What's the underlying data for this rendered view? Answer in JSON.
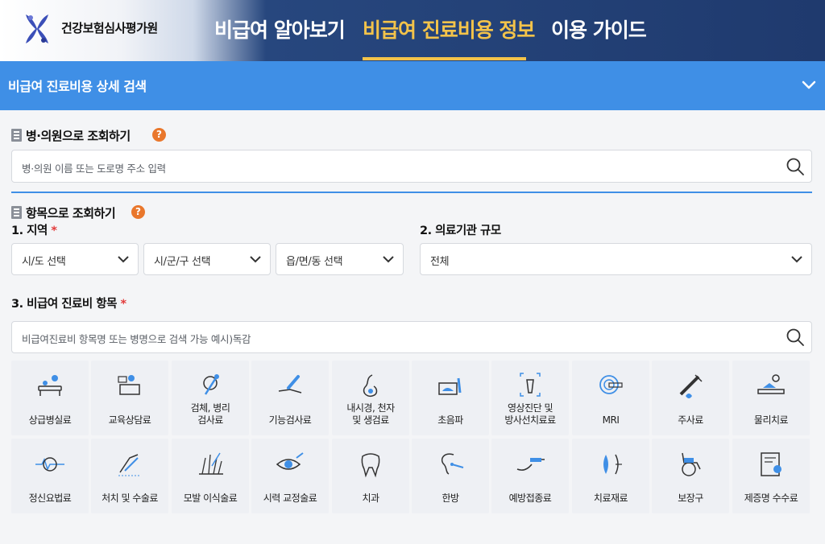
{
  "header": {
    "org_name": "건강보험심사평가원",
    "nav": [
      {
        "label": "비급여 알아보기",
        "active": false
      },
      {
        "label": "비급여 진료비용 정보",
        "active": true
      },
      {
        "label": "이용 가이드",
        "active": false
      }
    ]
  },
  "colors": {
    "primary": "#3f8fe6",
    "accent": "#f3c34a",
    "header_dark": "#1f3a6e",
    "help": "#e9772c",
    "required": "#e23b3b"
  },
  "bluebar": {
    "title": "비급여 진료비용 상세 검색"
  },
  "hospital_search": {
    "title": "병·의원으로 조회하기",
    "placeholder": "병·의원 이름 또는 도로명 주소 입력"
  },
  "item_search": {
    "title": "항목으로 조회하기",
    "region_label": "1. 지역",
    "region_selects": [
      "시/도 선택",
      "시/군/구 선택",
      "읍/면/동 선택"
    ],
    "scale_label": "2. 의료기관 규모",
    "scale_value": "전체",
    "item_label": "3. 비급여 진료비 항목",
    "item_placeholder": "비급여진료비 항목명 또는 병명으로 검색 가능 예시)독감",
    "required_mark": "*"
  },
  "categories": [
    {
      "label": "상급병실료",
      "icon": "hospital-bed-icon"
    },
    {
      "label": "교육상담료",
      "icon": "counseling-icon"
    },
    {
      "label": "검체, 병리\n검사료",
      "icon": "specimen-test-icon"
    },
    {
      "label": "기능검사료",
      "icon": "function-test-icon"
    },
    {
      "label": "내시경, 천자\n및 생검료",
      "icon": "endoscope-icon"
    },
    {
      "label": "초음파",
      "icon": "ultrasound-icon"
    },
    {
      "label": "영상진단 및\n방사선치료료",
      "icon": "imaging-icon"
    },
    {
      "label": "MRI",
      "icon": "mri-icon"
    },
    {
      "label": "주사료",
      "icon": "syringe-icon"
    },
    {
      "label": "물리치료",
      "icon": "physical-therapy-icon"
    },
    {
      "label": "정신요법료",
      "icon": "psychotherapy-icon"
    },
    {
      "label": "처치 및 수술료",
      "icon": "surgery-icon"
    },
    {
      "label": "모발 이식술료",
      "icon": "hair-transplant-icon"
    },
    {
      "label": "시력 교정술료",
      "icon": "eye-laser-icon"
    },
    {
      "label": "치과",
      "icon": "tooth-icon"
    },
    {
      "label": "한방",
      "icon": "acupuncture-icon"
    },
    {
      "label": "예방접종료",
      "icon": "vaccination-icon"
    },
    {
      "label": "치료재료",
      "icon": "treatment-material-icon"
    },
    {
      "label": "보장구",
      "icon": "wheelchair-icon"
    },
    {
      "label": "제증명 수수료",
      "icon": "certificate-icon"
    }
  ]
}
